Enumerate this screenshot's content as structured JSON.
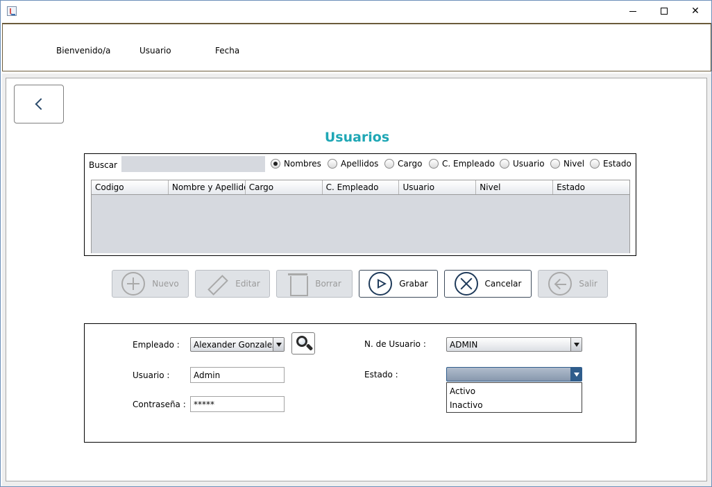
{
  "window": {
    "controls": {
      "minimize": "minimize",
      "maximize": "maximize",
      "close": "close"
    }
  },
  "header": {
    "welcome_label": "Bienvenido/a",
    "user_label": "Usuario",
    "date_label": "Fecha"
  },
  "page": {
    "title": "Usuarios"
  },
  "search": {
    "label": "Buscar",
    "value": "",
    "radio_options": [
      {
        "label": "Nombres",
        "checked": true
      },
      {
        "label": "Apellidos",
        "checked": false
      },
      {
        "label": "Cargo",
        "checked": false
      },
      {
        "label": "C. Empleado",
        "checked": false
      },
      {
        "label": "Usuario",
        "checked": false
      },
      {
        "label": "Nivel",
        "checked": false
      },
      {
        "label": "Estado",
        "checked": false
      }
    ]
  },
  "table": {
    "columns": [
      "Codigo",
      "Nombre y Apellido",
      "Cargo",
      "C. Empleado",
      "Usuario",
      "Nivel",
      "Estado"
    ],
    "rows": []
  },
  "actions": {
    "nuevo": {
      "label": "Nuevo",
      "enabled": false
    },
    "editar": {
      "label": "Editar",
      "enabled": false
    },
    "borrar": {
      "label": "Borrar",
      "enabled": false
    },
    "grabar": {
      "label": "Grabar",
      "enabled": true
    },
    "cancelar": {
      "label": "Cancelar",
      "enabled": true
    },
    "salir": {
      "label": "Salir",
      "enabled": false
    }
  },
  "form": {
    "empleado_label": "Empleado :",
    "empleado_value": "Alexander Gonzalez",
    "usuario_label": "Usuario :",
    "usuario_value": "Admin",
    "contrasena_label": "Contraseña :",
    "contrasena_value": "*****",
    "n_usuario_label": "N. de Usuario :",
    "n_usuario_value": "ADMIN",
    "estado_label": "Estado :",
    "estado_value": "",
    "estado_options": [
      "Activo",
      "Inactivo"
    ]
  },
  "colors": {
    "title": "#1fa7b5",
    "table_bg": "#d6d9df",
    "icon_enabled": "#1e3a5a",
    "icon_disabled": "#a9a9a9"
  }
}
